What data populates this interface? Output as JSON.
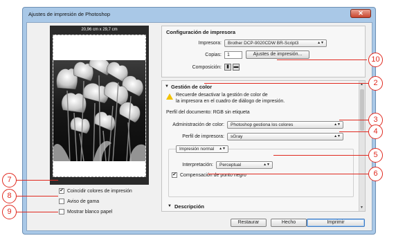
{
  "window": {
    "title": "Ajustes de impresión de Photoshop",
    "close_glyph": "✕"
  },
  "preview": {
    "dimensions": "20,96 cm x 29,7 cm"
  },
  "options": {
    "match_colors": {
      "label": "Coincidir colores de impresión",
      "checked": true
    },
    "gamut_warning": {
      "label": "Aviso de gama",
      "checked": false
    },
    "show_paper_white": {
      "label": "Mostrar blanco papel",
      "checked": false
    }
  },
  "printer_setup": {
    "title": "Configuración de impresora",
    "printer_label": "Impresora:",
    "printer_value": "Brother DCP-9020CDW BR-Script3",
    "copies_label": "Copias:",
    "copies_value": "1",
    "print_settings_button": "Ajustes de impresión...",
    "layout_label": "Composición:"
  },
  "color_management": {
    "title": "Gestión de color",
    "warning_line1": "Recuerde desactivar la gestión de color de",
    "warning_line2": "la impresora en el cuadro de diálogo de impresión.",
    "document_profile": "Perfil del documento: RGB sin etiqueta",
    "color_handling_label": "Administración de color:",
    "color_handling_value": "Photoshop gestiona los colores",
    "printer_profile_label": "Perfil de impresora:",
    "printer_profile_value": "sGray",
    "print_mode_value": "Impresión normal",
    "intent_label": "Interpretación:",
    "intent_value": "Perceptual",
    "bpc_label": "Compensación de punto negro",
    "bpc_checked": true,
    "description_title": "Descripción"
  },
  "buttons": {
    "restore": "Restaurar",
    "done": "Hecho",
    "print": "Imprimir"
  },
  "annotations": [
    "2",
    "3",
    "4",
    "5",
    "6",
    "7",
    "8",
    "9",
    "10"
  ],
  "colors": {
    "accent": "#e0281e",
    "window_frame": "#a9c8e7"
  }
}
